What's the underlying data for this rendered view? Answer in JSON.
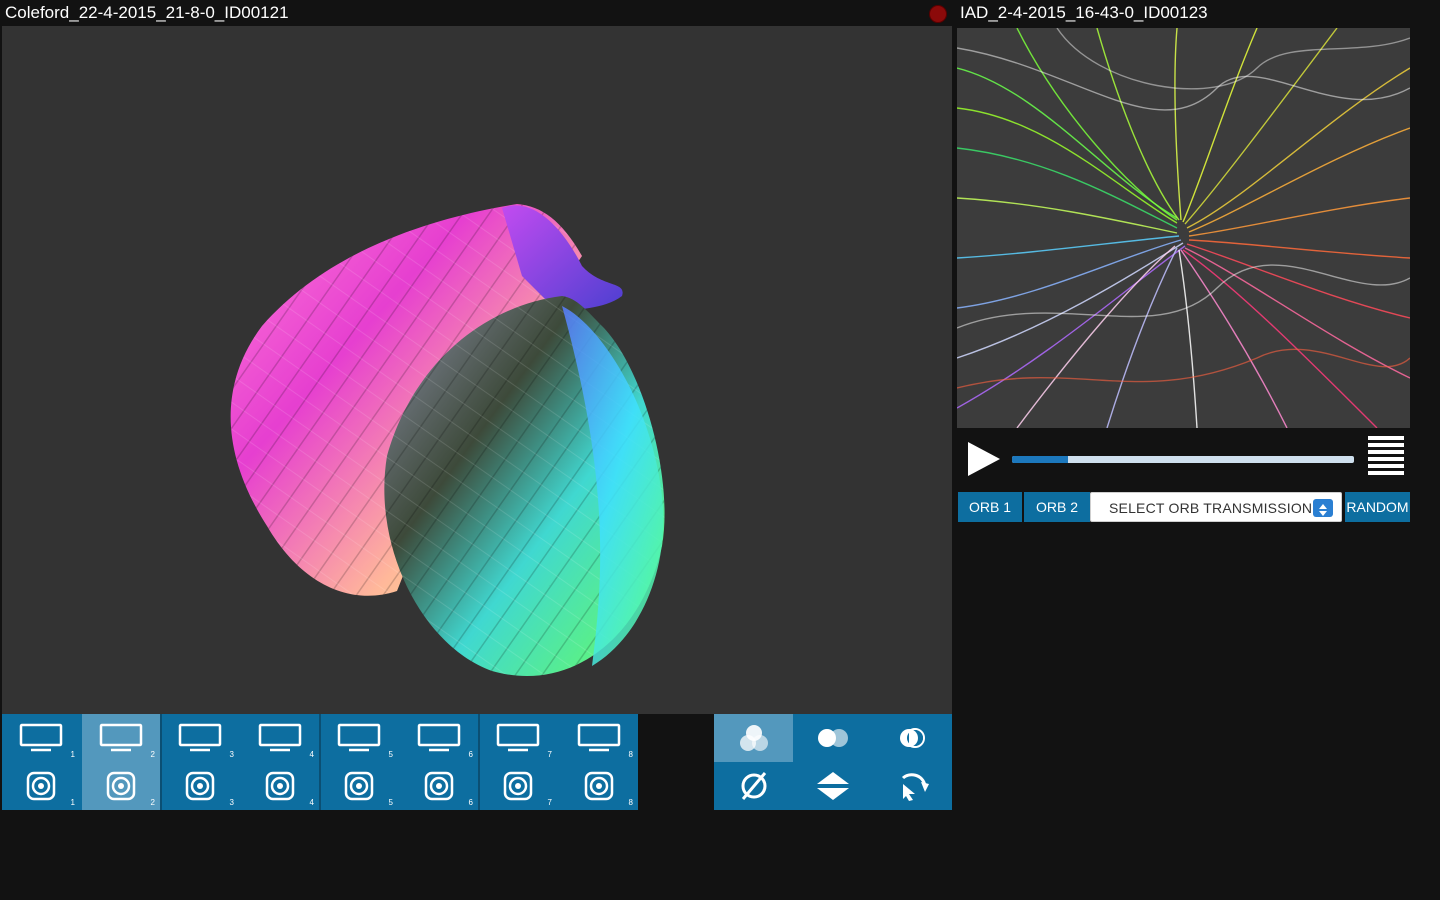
{
  "left_window": {
    "title": "Coleford_22-4-2015_21-8-0_ID00121",
    "record_icon": "record-dot-icon"
  },
  "right_window": {
    "title": "IAD_2-4-2015_16-43-0_ID00123",
    "playback_progress_fraction": 0.165,
    "play_icon": "play-icon",
    "menu_icon": "hamburger-menu-icon"
  },
  "orb_controls": {
    "orb1_label": "ORB 1",
    "orb2_label": "ORB 2",
    "select_value": "SELECT ORB TRANSMISSION",
    "random_label": "RANDOM"
  },
  "screen_channels": [
    {
      "number": "1",
      "icon": "monitor-icon",
      "active": false
    },
    {
      "number": "2",
      "icon": "monitor-icon",
      "active": true
    },
    {
      "number": "3",
      "icon": "monitor-icon",
      "active": false
    },
    {
      "number": "4",
      "icon": "monitor-icon",
      "active": false
    },
    {
      "number": "5",
      "icon": "monitor-icon",
      "active": false
    },
    {
      "number": "6",
      "icon": "monitor-icon",
      "active": false
    },
    {
      "number": "7",
      "icon": "monitor-icon",
      "active": false
    },
    {
      "number": "8",
      "icon": "monitor-icon",
      "active": false
    }
  ],
  "speaker_channels": [
    {
      "number": "1",
      "icon": "speaker-icon",
      "active": false
    },
    {
      "number": "2",
      "icon": "speaker-icon",
      "active": true
    },
    {
      "number": "3",
      "icon": "speaker-icon",
      "active": false
    },
    {
      "number": "4",
      "icon": "speaker-icon",
      "active": false
    },
    {
      "number": "5",
      "icon": "speaker-icon",
      "active": false
    },
    {
      "number": "6",
      "icon": "speaker-icon",
      "active": false
    },
    {
      "number": "7",
      "icon": "speaker-icon",
      "active": false
    },
    {
      "number": "8",
      "icon": "speaker-icon",
      "active": false
    }
  ],
  "mode_buttons": [
    {
      "icon": "three-circles-blend-icon",
      "active": true
    },
    {
      "icon": "two-circles-icon",
      "active": false
    },
    {
      "icon": "overlap-circles-icon",
      "active": false
    },
    {
      "icon": "visibility-off-icon",
      "active": false
    },
    {
      "icon": "move-vertical-icon",
      "active": false
    },
    {
      "icon": "rotate-cursor-icon",
      "active": false
    }
  ],
  "colors": {
    "panel_blue": "#0d6ea0",
    "active_cell": "#5398bd",
    "progress_fill": "#1c78bd",
    "viewport_bg": "#333333",
    "app_bg": "#121212"
  }
}
